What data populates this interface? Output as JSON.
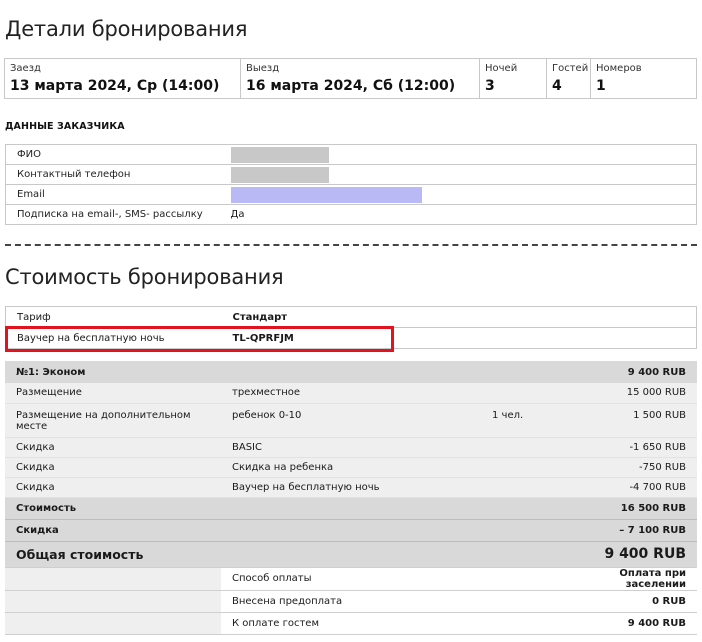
{
  "booking_details": {
    "title": "Детали бронирования",
    "checkin": {
      "label": "Заезд",
      "value": "13 марта 2024, Ср (14:00)"
    },
    "checkout": {
      "label": "Выезд",
      "value": "16 марта 2024, Сб (12:00)"
    },
    "nights": {
      "label": "Ночей",
      "value": "3"
    },
    "guests": {
      "label": "Гостей",
      "value": "4"
    },
    "rooms": {
      "label": "Номеров",
      "value": "1"
    }
  },
  "customer": {
    "title": "ДАННЫЕ ЗАКАЗЧИКА",
    "rows": [
      {
        "label": "ФИО",
        "value": "",
        "redact_color": "#c8c8c8"
      },
      {
        "label": "Контактный телефон",
        "value": "",
        "redact_color": "#c8c8c8"
      },
      {
        "label": "Email",
        "value": "",
        "redact_color": "#b9b9f5"
      },
      {
        "label": "Подписка на email-, SMS- рассылку",
        "value": "Да"
      }
    ]
  },
  "cost": {
    "title": "Стоимость бронирования",
    "tariff": {
      "label": "Тариф",
      "value": "Стандарт"
    },
    "voucher": {
      "label": "Ваучер на бесплатную ночь",
      "value": "TL-QPRFJM"
    },
    "highlight_color": "#e0131f",
    "room": {
      "name": "№1: Эконом",
      "amount": "9 400 RUB"
    },
    "lines": [
      {
        "label": "Размещение",
        "desc": "трехместное",
        "qty": "",
        "amount": "15 000 RUB"
      },
      {
        "label": "Размещение на дополнительном месте",
        "desc": "ребенок 0-10",
        "qty": "1 чел.",
        "amount": "1 500 RUB"
      },
      {
        "label": "Скидка",
        "desc": "BASIC",
        "qty": "",
        "amount": "-1 650 RUB"
      },
      {
        "label": "Скидка",
        "desc": "Скидка на ребенка",
        "qty": "",
        "amount": "-750 RUB"
      },
      {
        "label": "Скидка",
        "desc": "Ваучер на бесплатную ночь",
        "qty": "",
        "amount": "-4 700 RUB"
      }
    ],
    "subtotal": {
      "label": "Стоимость",
      "amount": "16 500 RUB"
    },
    "discount": {
      "label": "Скидка",
      "amount": "– 7 100 RUB"
    },
    "total": {
      "label": "Общая стоимость",
      "amount": "9 400 RUB"
    },
    "payment": [
      {
        "label": "Способ оплаты",
        "value": "Оплата при заселении"
      },
      {
        "label": "Внесена предоплата",
        "value": "0 RUB"
      },
      {
        "label": "К оплате гостем",
        "value": "9 400 RUB"
      }
    ]
  }
}
